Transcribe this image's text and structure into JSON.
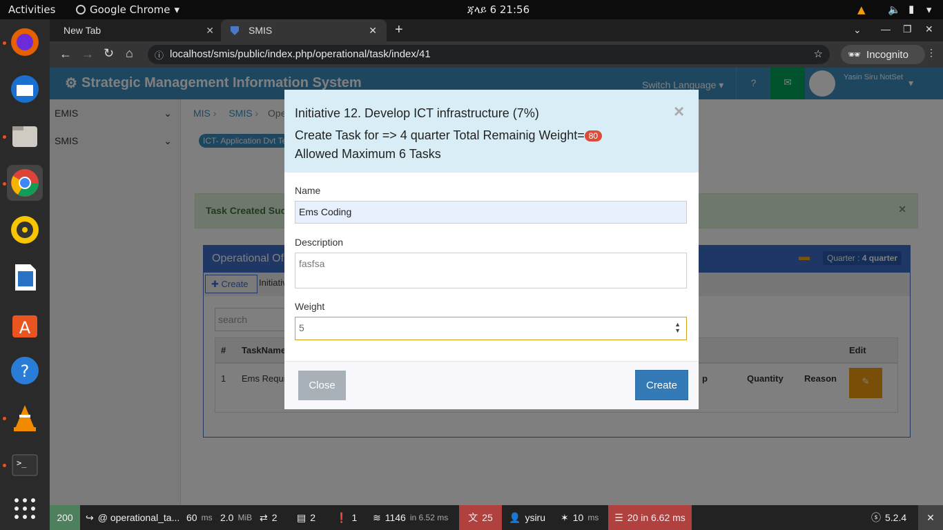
{
  "topbar": {
    "activities": "Activities",
    "app_menu": "Google Chrome",
    "clock": "ጃላይ 6  21:56"
  },
  "dock": {
    "apps": [
      "firefox-icon",
      "thunderbird-icon",
      "files-icon",
      "chrome-icon",
      "rhythmbox-icon",
      "writer-icon",
      "software-icon",
      "help-icon",
      "vlc-icon",
      "terminal-icon",
      "app-grid-icon"
    ]
  },
  "browser": {
    "tabs": [
      {
        "label": "New Tab"
      },
      {
        "label": "SMIS"
      }
    ],
    "url": "localhost/smis/public/index.php/operational/task/index/41",
    "profile": "Incognito"
  },
  "app": {
    "title": "Strategic Management Information System",
    "switch_language": "Switch Language",
    "user_name": "Yasin Siru NotSet",
    "sidebar": [
      "EMIS",
      "SMIS"
    ],
    "breadcrumb": [
      "MIS",
      "SMIS",
      "Ope"
    ],
    "plan_badge": "ICT- Application Dvt Te",
    "alert": "Task Created Suc",
    "panel_title": "Operational Of",
    "quarter_label": "Quarter : ",
    "quarter_value": "4 quarter",
    "create_btn": "Create",
    "initiative_tab": "Initiativ",
    "search_placeholder": "search",
    "table": {
      "headers": [
        "#",
        "TaskName",
        "Edit"
      ],
      "sub_headers": [
        "p",
        "Quantity",
        "Reason"
      ],
      "rows": [
        [
          "1",
          "Ems Requi"
        ]
      ]
    }
  },
  "modal": {
    "title": "Initiative 12. Develop ICT infrastructure (7%)",
    "subtitle": "Create Task for => 4 quarter Total Remainig Weight=",
    "remaining_weight": "80",
    "allowed": "Allowed Maximum 6 Tasks",
    "close_x": "×",
    "name_label": "Name",
    "name_value": "Ems Coding",
    "description_label": "Description",
    "description_value": "fasfsa",
    "weight_label": "Weight",
    "weight_value": "5",
    "close_btn": "Close",
    "create_btn": "Create",
    "colors": {
      "header_bg": "#d9edf7",
      "primary": "#337ab7",
      "badge": "#dd4b39"
    }
  },
  "sf_toolbar": {
    "status": "200",
    "route": "@ operational_ta...",
    "time": "60",
    "time_unit": "ms",
    "memory": "2.0",
    "memory_unit": "MiB",
    "forms": "2",
    "logs": "2",
    "warnings": "1",
    "cache": "1146",
    "cache_unit": "in 6.52 ms",
    "translations": "25",
    "user": "ysiru",
    "twig": "10",
    "twig_unit": "ms",
    "db": "20 in 6.62 ms",
    "version": "5.2.4"
  }
}
